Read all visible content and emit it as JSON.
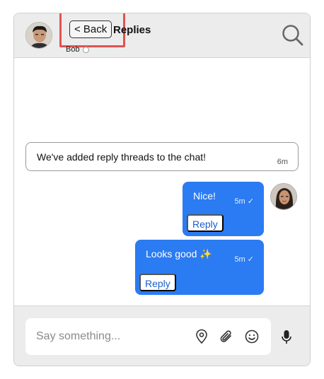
{
  "header": {
    "back_label": "< Back",
    "title": "Replies",
    "user_name": "Bob"
  },
  "messages": [
    {
      "type": "notice",
      "text": "We've added reply threads to the chat!",
      "time": "6m"
    },
    {
      "type": "own",
      "text": "Nice!",
      "time": "5m ✓",
      "reply_label": "Reply"
    },
    {
      "type": "own",
      "text": "Looks good ✨",
      "time": "5m ✓",
      "reply_label": "Reply"
    }
  ],
  "composer": {
    "placeholder": "Say something..."
  },
  "colors": {
    "accent": "#2b7bf2",
    "highlight": "#e05252",
    "header_bg": "#ececec"
  },
  "icons": [
    "search-icon",
    "location-pin-icon",
    "paperclip-icon",
    "emoji-icon",
    "microphone-icon"
  ]
}
